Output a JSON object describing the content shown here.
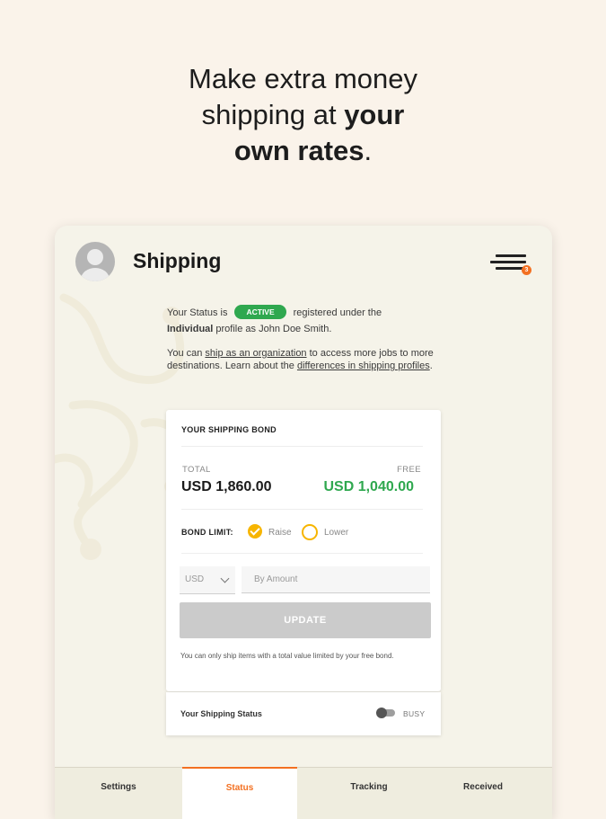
{
  "headline": {
    "line1": "Make extra money",
    "line2_plain": "shipping at ",
    "line2_bold": "your",
    "line3_bold": "own rates",
    "line3_plain": "."
  },
  "app": {
    "title": "Shipping",
    "menu_badge": "3"
  },
  "status": {
    "prefix": "Your Status is",
    "badge": "ACTIVE",
    "registered_under": "registered under the",
    "profile_bold": "Individual",
    "profile_rest": " profile as John Doe Smith.",
    "org_prefix": "You can ",
    "org_link": "ship as an organization",
    "org_middle": " to access more jobs to more destinations. Learn about the ",
    "diff_link": "differences in shipping profiles",
    "org_suffix": "."
  },
  "bond": {
    "title": "YOUR SHIPPING BOND",
    "total_label": "TOTAL",
    "total_value": "USD 1,860.00",
    "free_label": "FREE",
    "free_value": "USD 1,040.00",
    "limit_label": "BOND LIMIT:",
    "raise_label": "Raise",
    "lower_label": "Lower",
    "currency": "USD",
    "amount_placeholder": "By Amount",
    "update_label": "UPDATE",
    "note": "You can only ship items with a total value limited by your free bond."
  },
  "shipping_status": {
    "label": "Your Shipping Status",
    "state": "BUSY"
  },
  "tabs": [
    {
      "label": "Settings"
    },
    {
      "label": "Status"
    },
    {
      "label": "Tracking"
    },
    {
      "label": "Received"
    }
  ],
  "colors": {
    "background": "#faf3ea",
    "accent_orange": "#f37021",
    "active_green": "#2fa84f",
    "radio_yellow": "#f7b500"
  }
}
